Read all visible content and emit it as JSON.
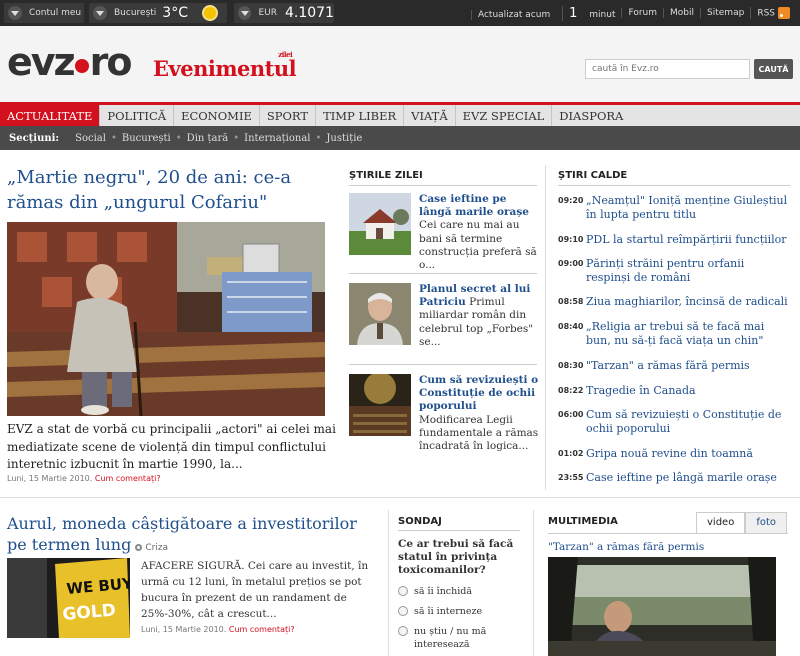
{
  "topbar": {
    "account": "Contul meu",
    "city": "București",
    "temperature": "3°C",
    "currency_label": "EUR",
    "currency_value": "4.1071",
    "updated_prefix": "Actualizat acum",
    "updated_num": "1",
    "updated_suffix": "minut",
    "links": [
      "Forum",
      "Mobil",
      "Sitemap",
      "RSS"
    ]
  },
  "header": {
    "logo_a": "evz",
    "logo_b": "ro",
    "logo2": "Evenimentul",
    "logo2_sup": "zilei",
    "search_placeholder": "caută în Evz.ro",
    "search_button": "CAUTĂ"
  },
  "nav": [
    "ACTUALITATE",
    "POLITICĂ",
    "ECONOMIE",
    "SPORT",
    "TIMP LIBER",
    "VIAȚĂ",
    "EVZ SPECIAL",
    "DIASPORA"
  ],
  "subnav": {
    "label": "Secțiuni:",
    "items": [
      "Social",
      "București",
      "Din țară",
      "Internațional",
      "Justiție"
    ]
  },
  "main_story": {
    "title": "„Martie negru\", 20 de ani: ce-a rămas din „ungurul Cofariu\"",
    "text": "EVZ a stat de vorbă cu principalii „actori\" ai celei mai mediatizate scene de violență din timpul conflictului interetnic izbucnit în martie 1990, la...",
    "date": "Luni, 15 Martie 2010.",
    "comments": "Cum comentați?"
  },
  "stirile_zilei": {
    "heading": "ȘTIRILE ZILEI",
    "items": [
      {
        "title": "Case ieftine pe lângă marile orașe",
        "text": "Cei care nu mai au bani să termine construcția preferă să o..."
      },
      {
        "title": "Planul secret al lui Patriciu",
        "text": "Primul miliardar român din celebrul top „Forbes\" se..."
      },
      {
        "title": "Cum să revizuiești o Constituție de ochii poporului",
        "text": "Modificarea Legii fundamentale a rămas încadrată în logica..."
      }
    ]
  },
  "stiri_calde": {
    "heading": "ȘTIRI CALDE",
    "items": [
      {
        "time": "09:20",
        "title": "„Neamțul\" Ioniță menține Giuleștiul în lupta pentru titlu"
      },
      {
        "time": "09:10",
        "title": "PDL la startul reîmpărțirii funcțiilor"
      },
      {
        "time": "09:00",
        "title": "Părinți străini pentru orfanii respinși de români"
      },
      {
        "time": "08:58",
        "title": "Ziua maghiarilor, încinsă de radicali"
      },
      {
        "time": "08:40",
        "title": "„Religia ar trebui să te facă mai bun, nu să-ți facă viața un chin\""
      },
      {
        "time": "08:30",
        "title": "\"Tarzan\" a rămas fără permis"
      },
      {
        "time": "08:22",
        "title": "Tragedie în Canada"
      },
      {
        "time": "06:00",
        "title": "Cum să revizuiești o Constituție de ochii poporului"
      },
      {
        "time": "01:02",
        "title": "Gripa nouă revine din toamnă"
      },
      {
        "time": "23:55",
        "title": "Case ieftine pe lângă marile orașe"
      }
    ]
  },
  "story2": {
    "title": "Aurul, moneda câștigătoare a investitorilor pe termen lung",
    "tag": "Criza",
    "text": "AFACERE SIGURĂ. Cei care au investit, în urmă cu 12 luni, în metalul prețios se pot bucura în prezent de un randament de 25%-30%, cât a crescut...",
    "date": "Luni, 15 Martie 2010.",
    "comments": "Cum comentați?",
    "image_text": [
      "WE BUY",
      "GOLD"
    ]
  },
  "sondaj": {
    "heading": "SONDAJ",
    "question": "Ce ar trebui să facă statul în privința toxicomanilor?",
    "options": [
      "să îi închidă",
      "să îi interneze",
      "nu știu / nu mă interesează"
    ]
  },
  "multimedia": {
    "heading": "MULTIMEDIA",
    "tabs": [
      "video",
      "foto"
    ],
    "caption": "\"Tarzan\" a rămas fără permis"
  }
}
